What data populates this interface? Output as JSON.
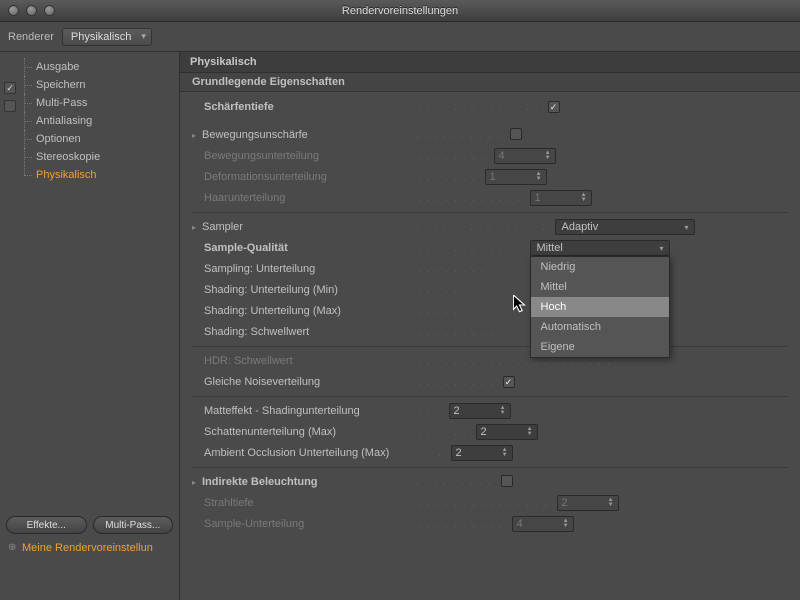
{
  "window": {
    "title": "Rendervoreinstellungen"
  },
  "topbar": {
    "renderer_label": "Renderer",
    "renderer_value": "Physikalisch"
  },
  "sidebar": {
    "items": [
      {
        "label": "Ausgabe",
        "checked": null
      },
      {
        "label": "Speichern",
        "checked": true
      },
      {
        "label": "Multi-Pass",
        "checked": false
      },
      {
        "label": "Antialiasing",
        "checked": null
      },
      {
        "label": "Optionen",
        "checked": null
      },
      {
        "label": "Stereoskopie",
        "checked": null
      },
      {
        "label": "Physikalisch",
        "checked": null,
        "active": true
      }
    ],
    "buttons": {
      "effects": "Effekte...",
      "multipass": "Multi-Pass..."
    },
    "preset": "Meine Rendervoreinstellun"
  },
  "panel": {
    "title": "Physikalisch",
    "group": "Grundlegende Eigenschaften",
    "rows": {
      "dof": {
        "label": "Schärfentiefe",
        "checked": true
      },
      "motion": {
        "label": "Bewegungsunschärfe",
        "checked": false
      },
      "motion_sub": {
        "label": "Bewegungsunterteilung",
        "value": "4"
      },
      "deform_sub": {
        "label": "Deformationsunterteilung",
        "value": "1"
      },
      "hair_sub": {
        "label": "Haarunterteilung",
        "value": "1"
      },
      "sampler": {
        "label": "Sampler",
        "value": "Adaptiv"
      },
      "quality": {
        "label": "Sample-Qualität",
        "value": "Mittel"
      },
      "sampling_sub": {
        "label": "Sampling: Unterteilung"
      },
      "shading_min": {
        "label": "Shading: Unterteilung (Min)"
      },
      "shading_max": {
        "label": "Shading: Unterteilung (Max)"
      },
      "shading_thresh": {
        "label": "Shading: Schwellwert"
      },
      "hdr_thresh": {
        "label": "HDR: Schwellwert"
      },
      "noise": {
        "label": "Gleiche Noiseverteilung",
        "checked": true
      },
      "matte": {
        "label": "Matteffekt - Shadingunterteilung",
        "value": "2"
      },
      "shadow": {
        "label": "Schattenunterteilung (Max)",
        "value": "2"
      },
      "ao": {
        "label": "Ambient Occlusion Unterteilung (Max)",
        "value": "2"
      },
      "gi": {
        "label": "Indirekte Beleuchtung",
        "checked": false
      },
      "raydepth": {
        "label": "Strahltiefe",
        "value": "2"
      },
      "sample_sub": {
        "label": "Sample-Unterteilung",
        "value": "4"
      }
    }
  },
  "dropdown": {
    "options": [
      "Niedrig",
      "Mittel",
      "Hoch",
      "Automatisch",
      "Eigene"
    ],
    "hover_index": 2
  }
}
